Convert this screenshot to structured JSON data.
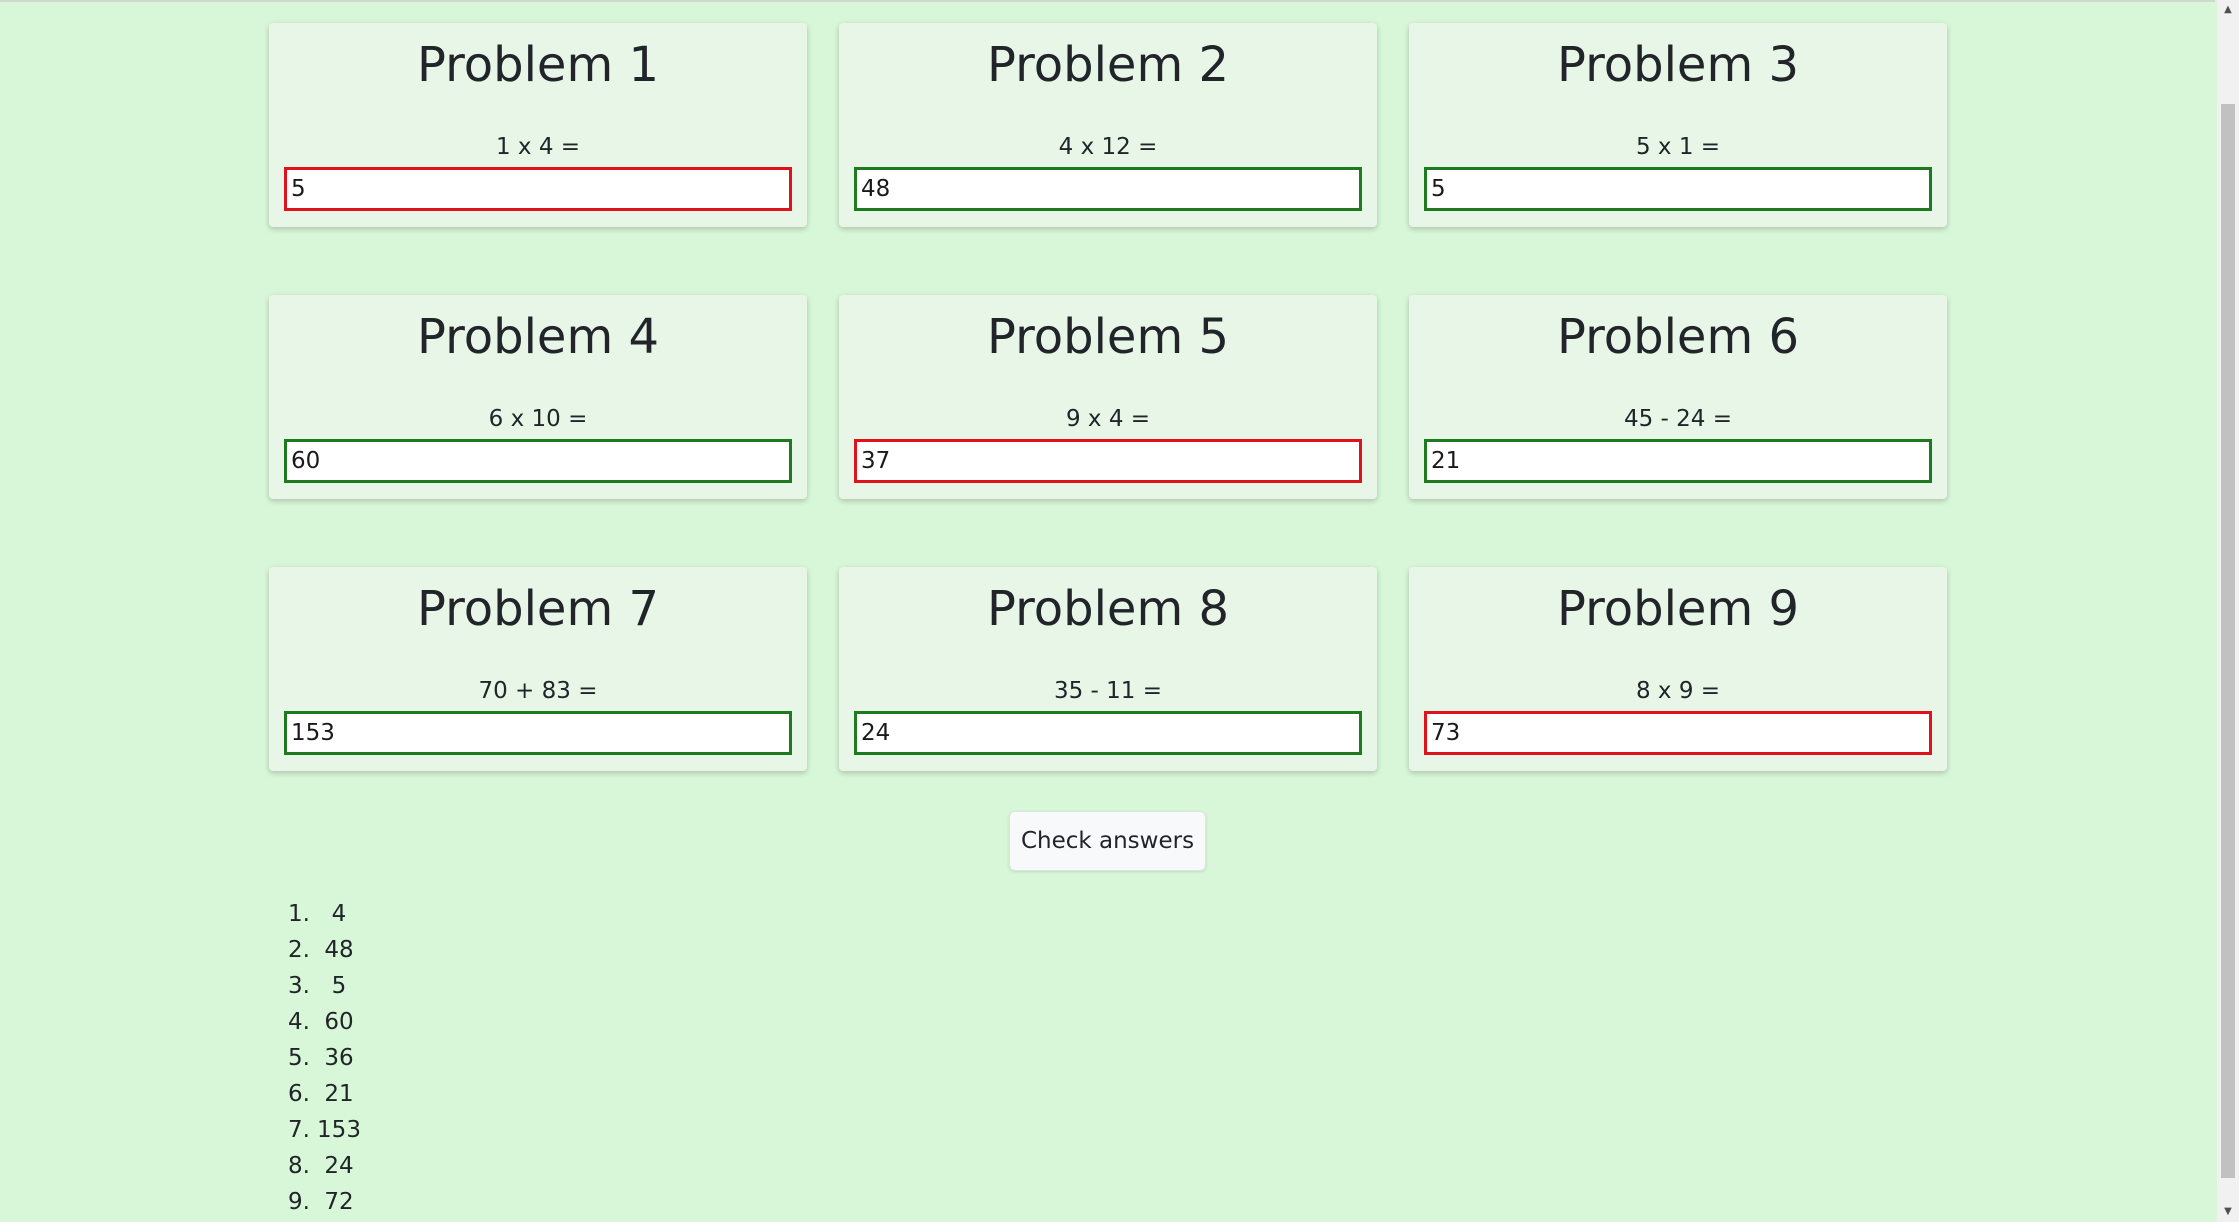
{
  "problems": [
    {
      "title": "Problem 1",
      "expr": "1 x 4 =",
      "value": "5",
      "status": "wrong"
    },
    {
      "title": "Problem 2",
      "expr": "4 x 12 =",
      "value": "48",
      "status": "correct"
    },
    {
      "title": "Problem 3",
      "expr": "5 x 1 =",
      "value": "5",
      "status": "correct"
    },
    {
      "title": "Problem 4",
      "expr": "6 x 10 =",
      "value": "60",
      "status": "correct"
    },
    {
      "title": "Problem 5",
      "expr": "9 x 4 =",
      "value": "37",
      "status": "wrong"
    },
    {
      "title": "Problem 6",
      "expr": "45 - 24 =",
      "value": "21",
      "status": "correct"
    },
    {
      "title": "Problem 7",
      "expr": "70 + 83 =",
      "value": "153",
      "status": "correct"
    },
    {
      "title": "Problem 8",
      "expr": "35 - 11 =",
      "value": "24",
      "status": "correct"
    },
    {
      "title": "Problem 9",
      "expr": "8 x 9 =",
      "value": "73",
      "status": "wrong"
    }
  ],
  "check_button_label": "Check answers",
  "answers": [
    {
      "num": "1.",
      "value": "4"
    },
    {
      "num": "2.",
      "value": "48"
    },
    {
      "num": "3.",
      "value": "5"
    },
    {
      "num": "4.",
      "value": "60"
    },
    {
      "num": "5.",
      "value": "36"
    },
    {
      "num": "6.",
      "value": "21"
    },
    {
      "num": "7.",
      "value": "153"
    },
    {
      "num": "8.",
      "value": "24"
    },
    {
      "num": "9.",
      "value": "72"
    }
  ],
  "colors": {
    "background": "#d8f7d8",
    "card": "#e8f6e8",
    "correct_border": "#1e7a1e",
    "wrong_border": "#e0121c"
  },
  "scrollbar": {
    "up_icon": "▲",
    "down_icon": "▼"
  }
}
